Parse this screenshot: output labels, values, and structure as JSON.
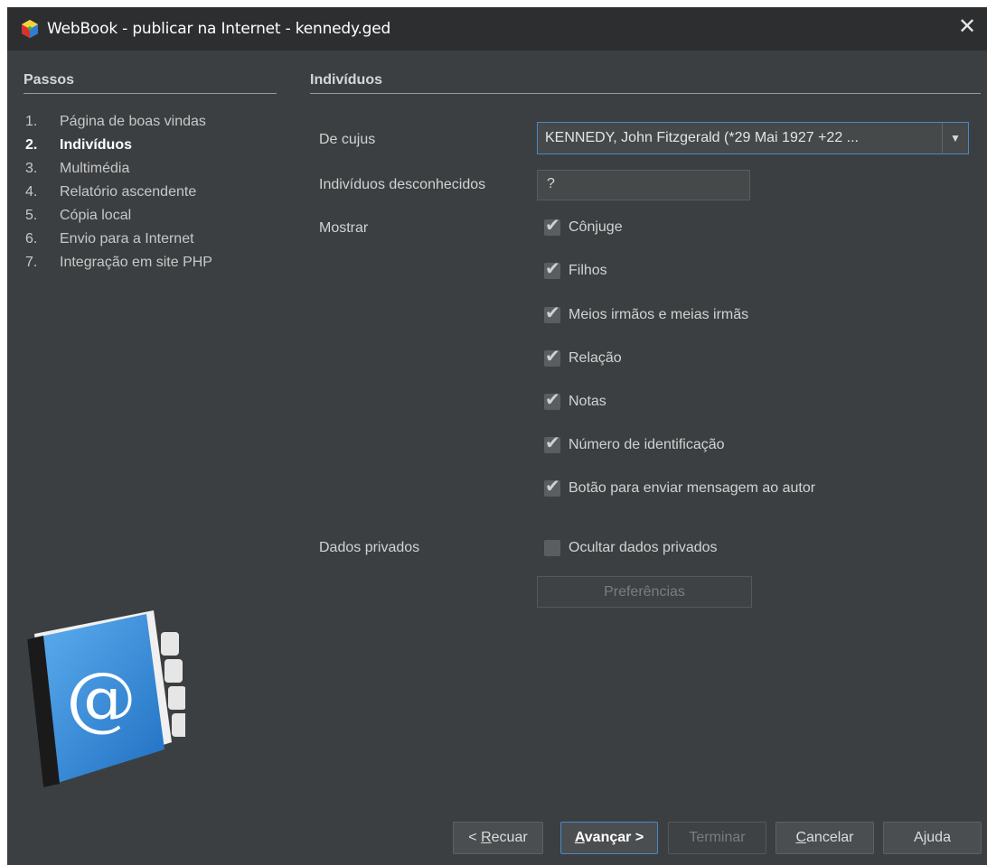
{
  "window": {
    "title": "WebBook - publicar na Internet - kennedy.ged",
    "close_glyph": "✕"
  },
  "steps_panel": {
    "heading": "Passos",
    "items": [
      {
        "num": "1.",
        "label": "Página de boas vindas",
        "active": false
      },
      {
        "num": "2.",
        "label": "Indivíduos",
        "active": true
      },
      {
        "num": "3.",
        "label": "Multimédia",
        "active": false
      },
      {
        "num": "4.",
        "label": "Relatório ascendente",
        "active": false
      },
      {
        "num": "5.",
        "label": "Cópia local",
        "active": false
      },
      {
        "num": "6.",
        "label": "Envio para a Internet",
        "active": false
      },
      {
        "num": "7.",
        "label": "Integração em site PHP",
        "active": false
      }
    ]
  },
  "main": {
    "heading": "Indivíduos",
    "de_cujus": {
      "label": "De cujus",
      "value": "KENNEDY, John Fitzgerald (*29 Mai 1927 +22 ..."
    },
    "unknown": {
      "label": "Indivíduos desconhecidos",
      "value": "?"
    },
    "mostrar": {
      "label": "Mostrar",
      "options": [
        {
          "label": "Cônjuge",
          "checked": true
        },
        {
          "label": "Filhos",
          "checked": true
        },
        {
          "label": "Meios irmãos e meias irmãs",
          "checked": true
        },
        {
          "label": "Relação",
          "checked": true
        },
        {
          "label": "Notas",
          "checked": true
        },
        {
          "label": "Número de identificação",
          "checked": true
        },
        {
          "label": "Botão para enviar mensagem ao autor",
          "checked": true
        }
      ]
    },
    "private": {
      "label": "Dados privados",
      "option": {
        "label": "Ocultar dados privados",
        "checked": false
      },
      "preferences_button": "Preferências"
    }
  },
  "buttons": {
    "back": {
      "prefix": "< ",
      "mnemonic": "R",
      "rest": "ecuar"
    },
    "next": {
      "mnemonic": "A",
      "rest": "vançar >"
    },
    "finish": "Terminar",
    "cancel": {
      "mnemonic": "C",
      "rest": "ancelar"
    },
    "help": {
      "prefix": "A",
      "mnemonic": "j",
      "rest": "uda"
    }
  },
  "illustration": {
    "icon": "address-book-icon",
    "symbol": "@"
  },
  "colors": {
    "background": "#3c3f41",
    "titlebar": "#2c2e30",
    "accent": "#4a88c7",
    "book_blue": "#2f86d6"
  }
}
